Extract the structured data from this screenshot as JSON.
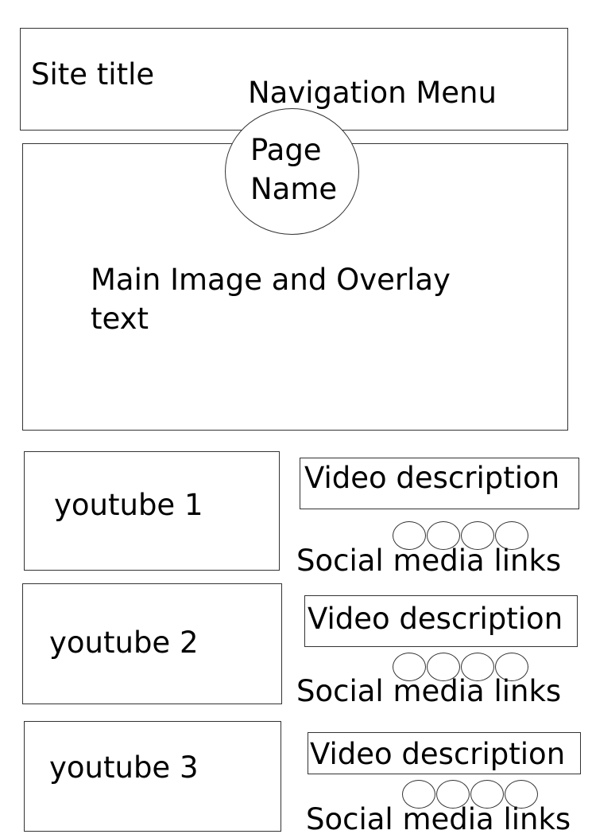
{
  "header": {
    "site_title": "Site title",
    "nav_menu": "Navigation Menu"
  },
  "page_name": {
    "line1": "Page",
    "line2": "Name"
  },
  "hero": {
    "line1": "Main Image and Overlay",
    "line2": "text"
  },
  "videos": [
    {
      "label": "youtube 1",
      "description": "Video description",
      "social": "Social media links"
    },
    {
      "label": "youtube 2",
      "description": "Video description",
      "social": "Social media links"
    },
    {
      "label": "youtube 3",
      "description": "Video description",
      "social": "Social media links"
    }
  ]
}
